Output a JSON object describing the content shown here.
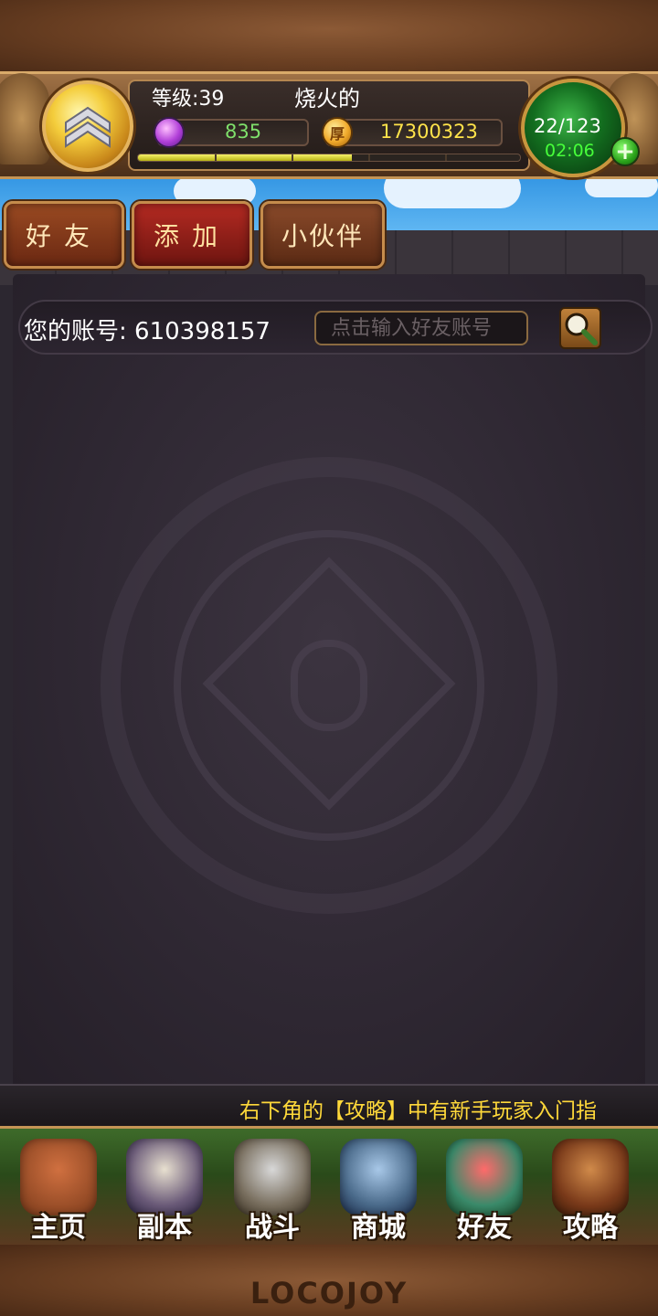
{
  "header": {
    "level_label": "等级:39",
    "player_name": "烧火的",
    "gems": "835",
    "gold": "17300323",
    "gold_icon_glyph": "厚",
    "exp_progress": 0.56,
    "energy": "22/123",
    "energy_timer": "02:06",
    "plus_glyph": "+"
  },
  "tabs": [
    {
      "label": "好友"
    },
    {
      "label": "添加"
    },
    {
      "label": "小伙伴"
    }
  ],
  "search": {
    "account_label": "您的账号: 610398157",
    "placeholder": "点击输入好友账号"
  },
  "ticker": {
    "text": "右下角的【攻略】中有新手玩家入门指"
  },
  "nav": [
    {
      "label": "主页",
      "icon": "house-icon",
      "color": "#a5532c"
    },
    {
      "label": "副本",
      "icon": "skull-icon",
      "color": "#6a5a78"
    },
    {
      "label": "战斗",
      "icon": "sword-icon",
      "color": "#7a7060"
    },
    {
      "label": "商城",
      "icon": "monster-icon",
      "color": "#4a6a8a"
    },
    {
      "label": "好友",
      "icon": "friends-icon",
      "color": "#3a8a6a"
    },
    {
      "label": "攻略",
      "icon": "book-icon",
      "color": "#7a3a1a"
    }
  ],
  "footer": {
    "logo": "LOCOJOY"
  },
  "colors": {
    "gem_value": "#7fe06b",
    "gold_value": "#ffe34a",
    "energy_timer": "#47ff3a",
    "ticker": "#ffd93a"
  }
}
